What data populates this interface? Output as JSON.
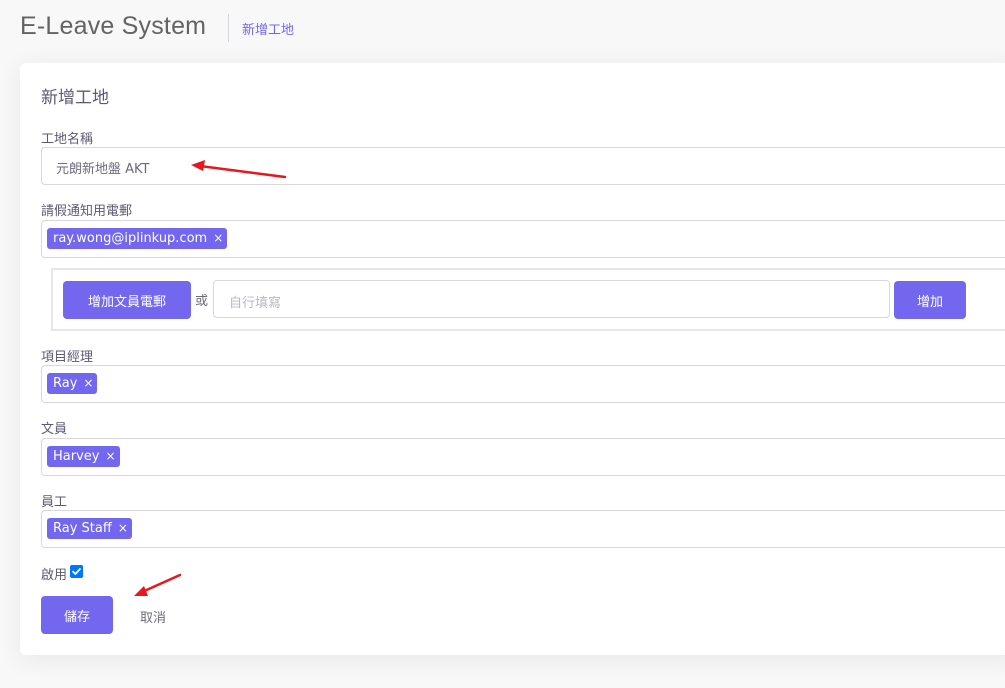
{
  "header": {
    "app_title": "E-Leave System",
    "breadcrumb": "新增工地"
  },
  "form": {
    "title": "新增工地",
    "site_name": {
      "label": "工地名稱",
      "value": "元朗新地盤 AKT"
    },
    "notify_email": {
      "label": "請假通知用電郵",
      "tags": [
        "ray.wong@iplinkup.com"
      ]
    },
    "email_panel": {
      "add_clerk_button": "增加文員電郵",
      "or_text": "或",
      "manual_placeholder": "自行填寫",
      "add_button": "增加"
    },
    "project_manager": {
      "label": "項目經理",
      "tags": [
        "Ray"
      ]
    },
    "clerk": {
      "label": "文員",
      "tags": [
        "Harvey"
      ]
    },
    "staff": {
      "label": "員工",
      "tags": [
        "Ray Staff"
      ]
    },
    "enabled": {
      "label": "啟用",
      "checked": true
    },
    "save_button": "儲存",
    "cancel_button": "取消",
    "tag_remove_symbol": "×"
  },
  "colors": {
    "primary": "#7367f0",
    "annotation_arrow": "#e8171d"
  }
}
